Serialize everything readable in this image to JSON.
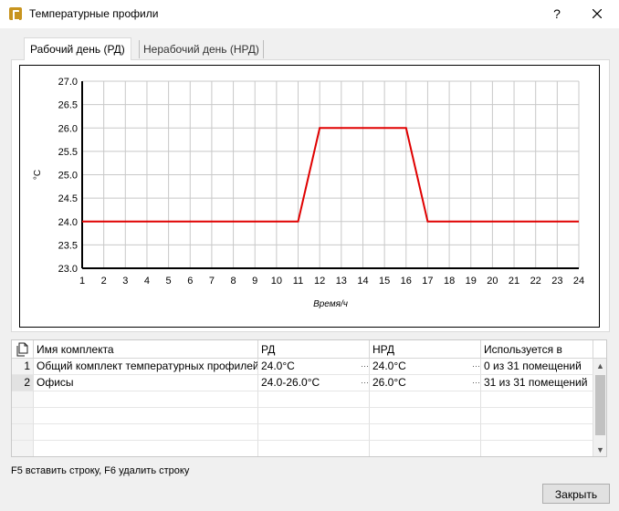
{
  "window": {
    "title": "Температурные профили",
    "help": "?"
  },
  "tabs": [
    {
      "label": "Рабочий день (РД)",
      "active": true
    },
    {
      "label": "Нерабочий день (НРД)",
      "active": false
    }
  ],
  "chart_data": {
    "type": "line",
    "ylabel": "°C",
    "xlabel": "Время/ч",
    "xlim": [
      1,
      24
    ],
    "ylim": [
      23.0,
      27.0
    ],
    "x_ticks": [
      1,
      2,
      3,
      4,
      5,
      6,
      7,
      8,
      9,
      10,
      11,
      12,
      13,
      14,
      15,
      16,
      17,
      18,
      19,
      20,
      21,
      22,
      23,
      24
    ],
    "y_ticks": [
      "23.0",
      "23.5",
      "24.0",
      "24.5",
      "25.0",
      "25.5",
      "26.0",
      "26.5",
      "27.0"
    ],
    "grid": true,
    "series": [
      {
        "x": [
          1,
          11,
          12,
          16,
          17,
          24
        ],
        "y": [
          24.0,
          24.0,
          26.0,
          26.0,
          24.0,
          24.0
        ],
        "color": "#e00000"
      }
    ]
  },
  "table": {
    "headers": [
      "Имя комплекта",
      "РД",
      "НРД",
      "Используется в"
    ],
    "rows": [
      {
        "num": "1",
        "name": "Общий комплект температурных профилей",
        "rd": "24.0°C",
        "nrd": "24.0°C",
        "used": "0 из 31 помещений"
      },
      {
        "num": "2",
        "name": "Офисы",
        "rd": "24.0-26.0°C",
        "nrd": "26.0°C",
        "used": "31 из 31 помещений"
      }
    ],
    "ellipsis": "···"
  },
  "status": "F5 вставить строку, F6 удалить строку",
  "buttons": {
    "close": "Закрыть"
  },
  "colors": {
    "series": "#e00000",
    "grid": "#c8c8c8",
    "accent_icon": "#c8941e"
  }
}
